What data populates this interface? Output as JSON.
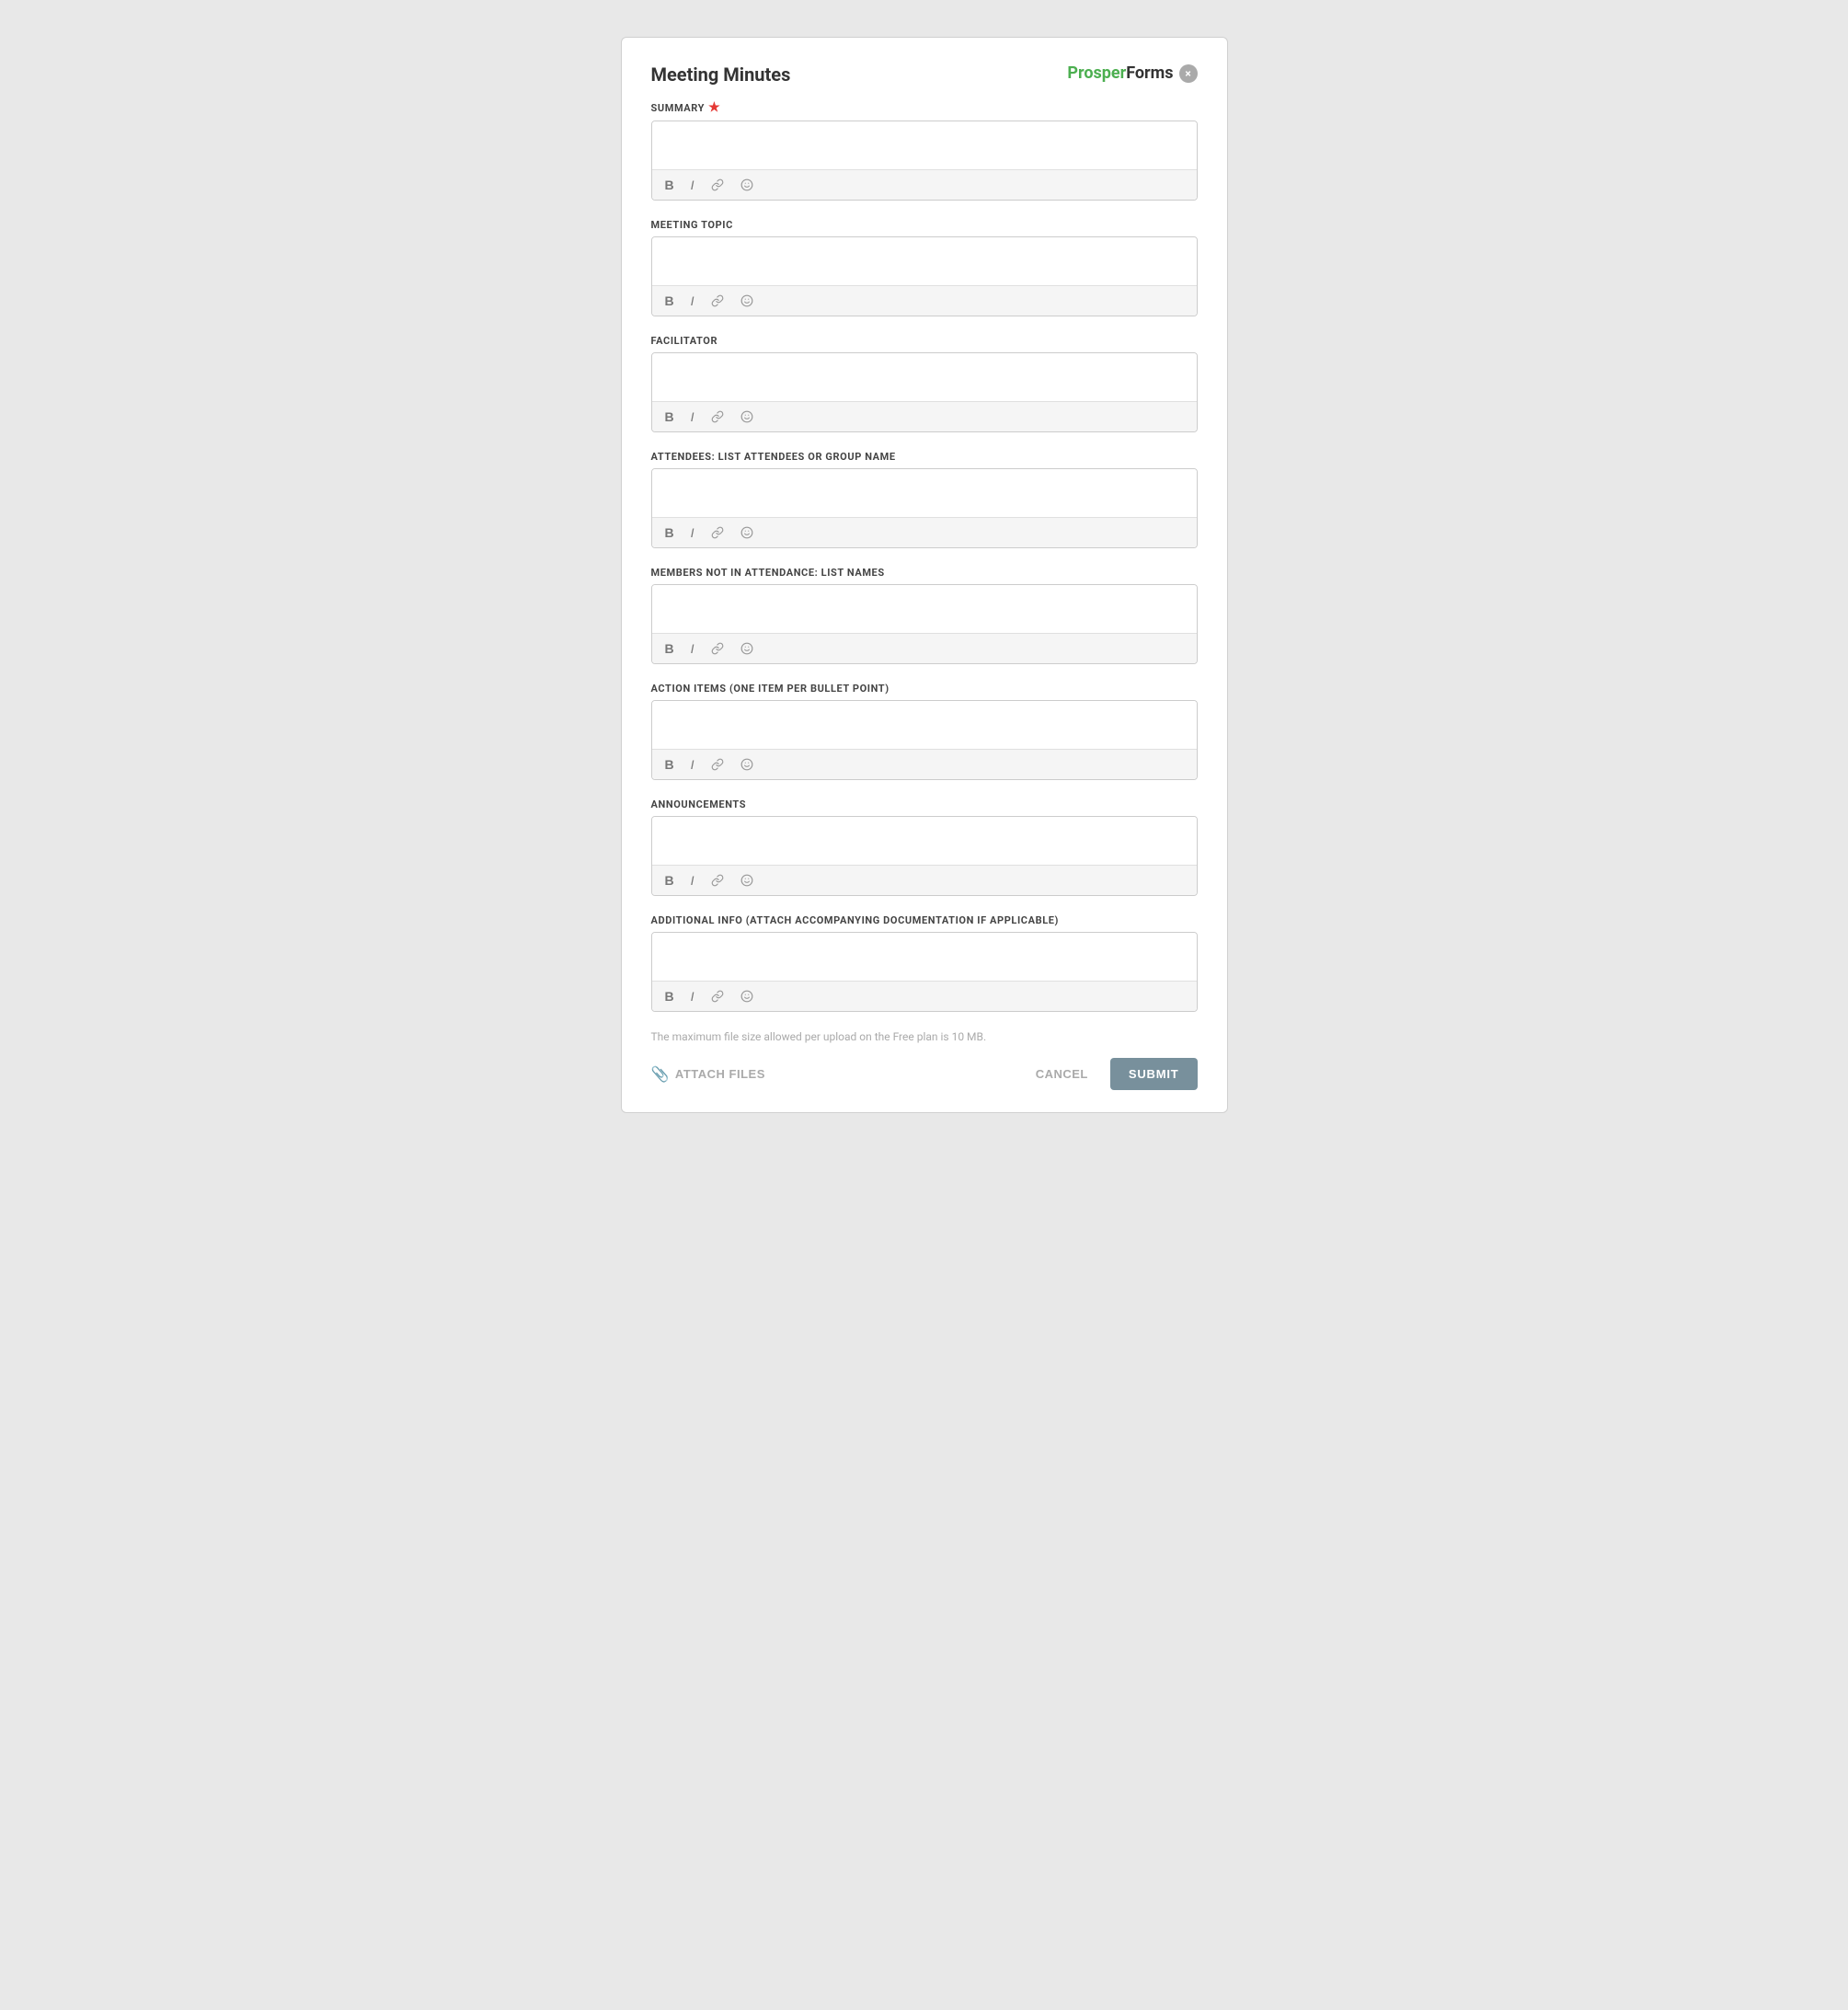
{
  "header": {
    "title": "Meeting Minutes",
    "subtitle": "SUMMARY",
    "required_indicator": "★",
    "logo_prosper": "Prosper",
    "logo_forms": "Forms",
    "close_label": "×"
  },
  "fields": [
    {
      "id": "summary",
      "label": "SUMMARY",
      "required": true,
      "placeholder": ""
    },
    {
      "id": "meeting_topic",
      "label": "MEETING TOPIC",
      "required": false,
      "placeholder": ""
    },
    {
      "id": "facilitator",
      "label": "FACILITATOR",
      "required": false,
      "placeholder": ""
    },
    {
      "id": "attendees",
      "label": "ATTENDEES: LIST ATTENDEES OR GROUP NAME",
      "required": false,
      "placeholder": ""
    },
    {
      "id": "members_not_in_attendance",
      "label": "MEMBERS NOT IN ATTENDANCE: LIST NAMES",
      "required": false,
      "placeholder": ""
    },
    {
      "id": "action_items",
      "label": "ACTION ITEMS (ONE ITEM PER BULLET POINT)",
      "required": false,
      "placeholder": ""
    },
    {
      "id": "announcements",
      "label": "ANNOUNCEMENTS",
      "required": false,
      "placeholder": ""
    },
    {
      "id": "additional_info",
      "label": "ADDITIONAL INFO (ATTACH ACCOMPANYING DOCUMENTATION IF APPLICABLE)",
      "required": false,
      "placeholder": ""
    }
  ],
  "toolbar": {
    "bold": "B",
    "italic": "I",
    "link": "🔗",
    "emoji": "🙂"
  },
  "footer": {
    "file_size_note": "The maximum file size allowed per upload on the Free plan is 10 MB.",
    "attach_label": "ATTACH FILES",
    "cancel_label": "CANCEL",
    "submit_label": "SUBMIT"
  }
}
